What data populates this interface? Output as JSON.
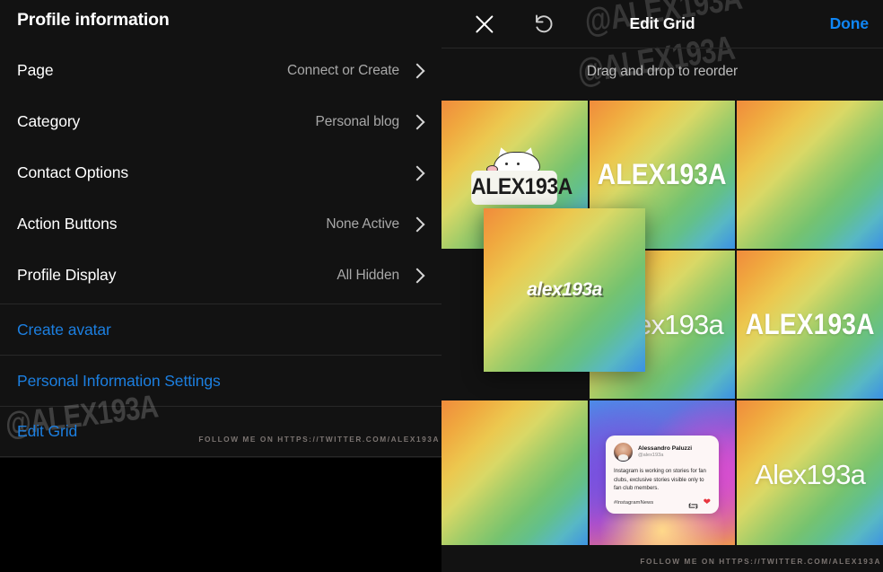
{
  "left_panel": {
    "title": "Profile information",
    "settings": [
      {
        "label": "Page",
        "value": "Connect or Create"
      },
      {
        "label": "Category",
        "value": "Personal blog"
      },
      {
        "label": "Contact Options",
        "value": ""
      },
      {
        "label": "Action Buttons",
        "value": "None Active"
      },
      {
        "label": "Profile Display",
        "value": "All Hidden"
      }
    ],
    "links": [
      {
        "label": "Create avatar"
      },
      {
        "label": "Personal Information Settings"
      },
      {
        "label": "Edit Grid"
      }
    ],
    "watermark": "@ALEX193A",
    "footer": "FOLLOW ME ON HTTPS://TWITTER.COM/ALEX193A"
  },
  "right_panel": {
    "header": {
      "close_label": "close",
      "undo_label": "undo",
      "title": "Edit Grid",
      "done_label": "Done"
    },
    "hint": "Drag and drop to reorder",
    "watermark": "@ALEX193A",
    "footer": "FOLLOW ME ON HTTPS://TWITTER.COM/ALEX193A",
    "tiles": [
      {
        "id": "tile-1",
        "kind": "logo",
        "text": "ALEX193A"
      },
      {
        "id": "tile-2",
        "kind": "condensed",
        "text": "ALEX193A"
      },
      {
        "id": "tile-3",
        "kind": "plain",
        "text": ""
      },
      {
        "id": "tile-4",
        "kind": "empty",
        "text": ""
      },
      {
        "id": "tile-5",
        "kind": "light-offset",
        "text": "Alex193a"
      },
      {
        "id": "tile-6",
        "kind": "condensed",
        "text": "ALEX193A"
      },
      {
        "id": "tile-7",
        "kind": "plain",
        "text": ""
      },
      {
        "id": "tile-8",
        "kind": "tweet",
        "text": ""
      },
      {
        "id": "tile-9",
        "kind": "light",
        "text": "Alex193a"
      }
    ],
    "dragged_tile": {
      "text": "alex193a"
    },
    "tweet": {
      "name": "Alessandro Paluzzi",
      "handle": "@alex193a",
      "body": "Instagram is working on stories for fan clubs, exclusive stories visible only to fan club members.",
      "hashtag": "#InstagramNews"
    }
  },
  "colors": {
    "accent_blue": "#0f86f5",
    "link_blue": "#1c7fe0",
    "panel_bg": "#121212",
    "text_primary": "#ffffff",
    "text_secondary": "#a8a8a8"
  }
}
